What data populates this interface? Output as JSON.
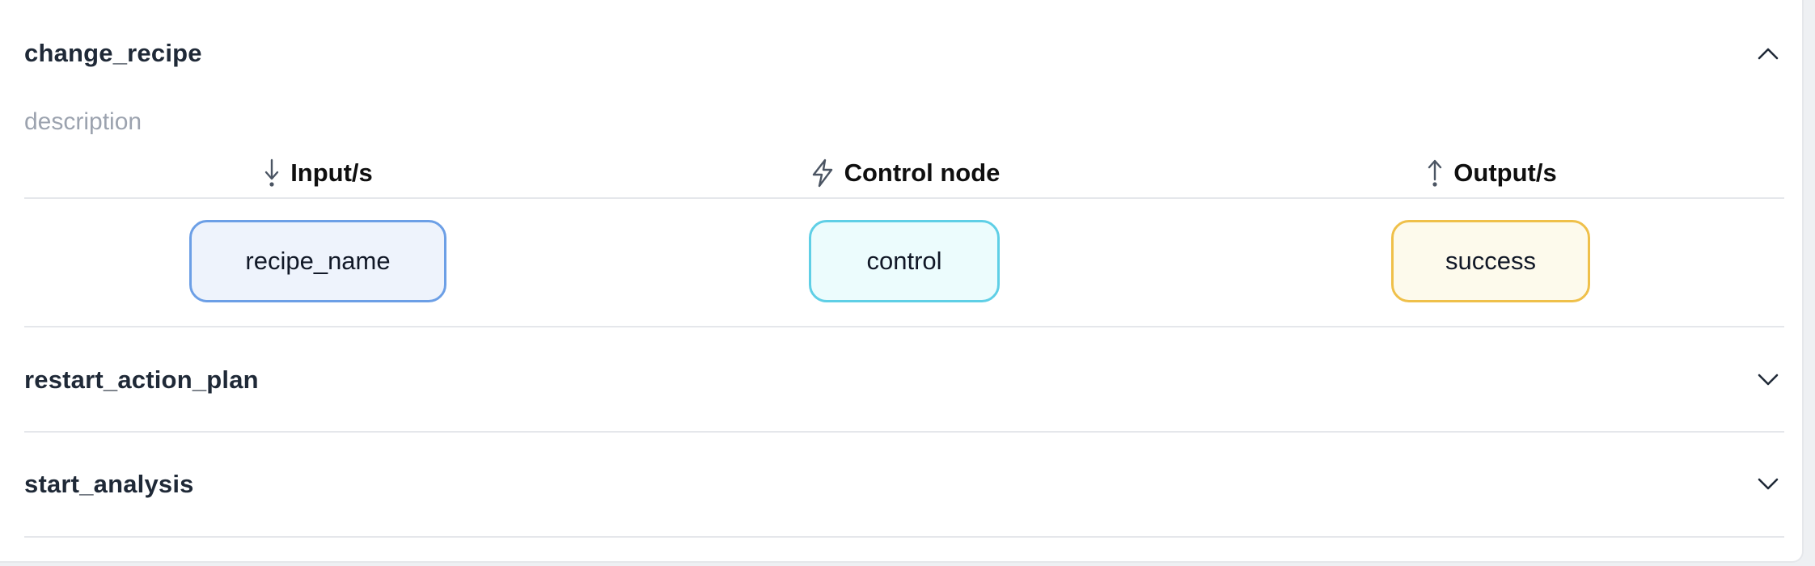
{
  "sections": [
    {
      "title": "change_recipe",
      "expanded": true,
      "description": "description",
      "columns": {
        "inputs": {
          "label": "Input/s",
          "icon": "arrow-down-icon"
        },
        "control": {
          "label": "Control node",
          "icon": "lightning-icon"
        },
        "outputs": {
          "label": "Output/s",
          "icon": "arrow-up-icon"
        }
      },
      "nodes": {
        "input": "recipe_name",
        "control": "control",
        "output": "success"
      }
    },
    {
      "title": "restart_action_plan",
      "expanded": false
    },
    {
      "title": "start_analysis",
      "expanded": false
    }
  ],
  "colors": {
    "input_border": "#6c9fe6",
    "input_fill": "#eef3fc",
    "control_border": "#5fcfe6",
    "control_fill": "#ecfcfd",
    "output_border": "#efc04a",
    "output_fill": "#fdfaec"
  }
}
